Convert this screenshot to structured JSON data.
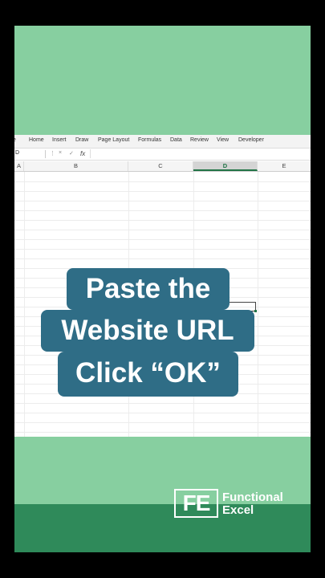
{
  "ribbon": {
    "tabs": [
      "e",
      "Home",
      "Insert",
      "Draw",
      "Page Layout",
      "Formulas",
      "Data",
      "Review",
      "View",
      "Developer"
    ]
  },
  "formula_bar": {
    "name_box": "D",
    "cancel": "×",
    "enter": "✓",
    "fx": "fx"
  },
  "columns": [
    "A",
    "B",
    "C",
    "D",
    "E"
  ],
  "selected_column": "D",
  "caption": {
    "line1": "Paste the",
    "line2": "Website URL",
    "line3": "Click “OK”"
  },
  "brand": {
    "logo": "FE",
    "line1": "Functional",
    "line2": "Excel"
  },
  "colors": {
    "green_band": "#87cfa0",
    "dark_green": "#2f8a5a",
    "caption_bg": "#2f6d86",
    "excel_green": "#217346"
  }
}
